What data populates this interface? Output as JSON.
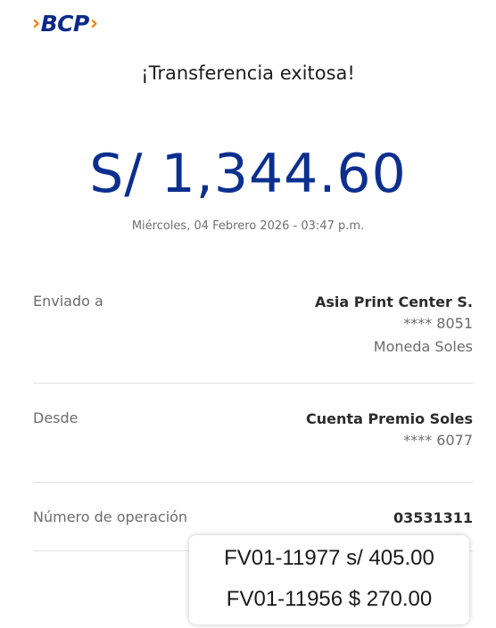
{
  "brand": {
    "name": "BCP",
    "chevron_left": "›",
    "chevron_right": "›",
    "colors": {
      "primary": "#0a2a8a",
      "accent": "#ff7800"
    }
  },
  "header": {
    "title": "¡Transferencia exitosa!"
  },
  "transfer": {
    "amount": "S/ 1,344.60",
    "datetime": "Miércoles, 04 Febrero 2026 - 03:47 p.m."
  },
  "details": {
    "recipient": {
      "label": "Enviado a",
      "name": "Asia Print Center S.",
      "account": "**** 8051",
      "currency": "Moneda Soles"
    },
    "source": {
      "label": "Desde",
      "name": "Cuenta Premio Soles",
      "account": "**** 6077"
    },
    "operation": {
      "label": "Número de operación",
      "number": "03531311"
    }
  },
  "annotation": {
    "line1": "FV01-11977 s/ 405.00",
    "line2": "FV01-11956 $ 270.00"
  }
}
